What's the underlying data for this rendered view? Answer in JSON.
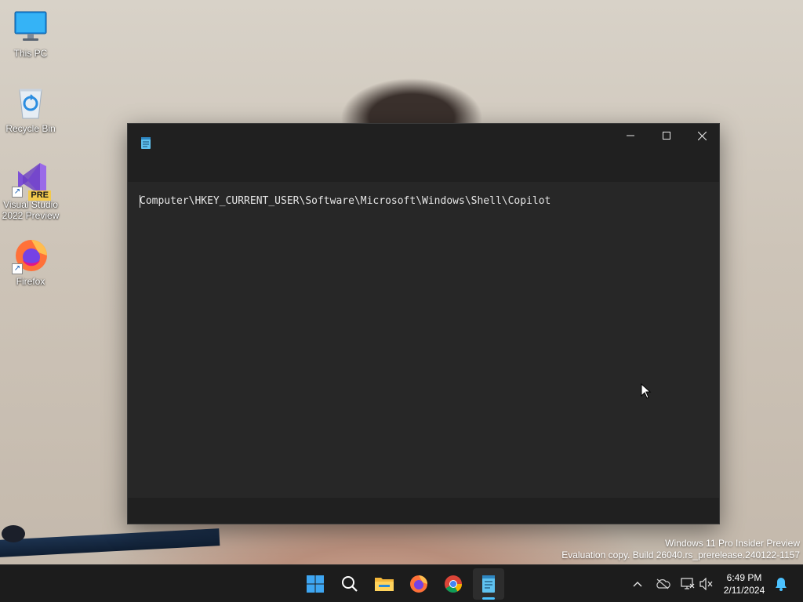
{
  "desktop": {
    "icons": [
      {
        "label": "This PC",
        "icon": "monitor-icon"
      },
      {
        "label": "Recycle Bin",
        "icon": "recycle-bin-icon"
      },
      {
        "label_line1": "Visual Studio",
        "label_line2": "2022 Preview",
        "badge": "PRE",
        "icon": "visual-studio-icon"
      },
      {
        "label": "Firefox",
        "icon": "firefox-icon"
      }
    ]
  },
  "window": {
    "app": "Notepad",
    "icon": "notepad-icon",
    "controls": [
      "minimize",
      "maximize",
      "close"
    ],
    "editor_text": "Computer\\HKEY_CURRENT_USER\\Software\\Microsoft\\Windows\\Shell\\Copilot"
  },
  "watermark": {
    "line1": "Windows 11 Pro Insider Preview",
    "line2": "Evaluation copy. Build 26040.rs_prerelease.240122-1157"
  },
  "taskbar": {
    "apps": [
      "start",
      "search",
      "file-explorer",
      "firefox",
      "chrome",
      "notepad"
    ],
    "active_app": "notepad",
    "tray": [
      "show-hidden-icons",
      "onedrive",
      "network",
      "volume-muted"
    ],
    "time": "6:49 PM",
    "date": "2/11/2024",
    "notification": "bell-icon"
  },
  "colors": {
    "window_bg": "#272727",
    "titlebar_bg": "#202020",
    "taskbar_bg": "#1c1c1c",
    "accent": "#4cc2ff"
  }
}
